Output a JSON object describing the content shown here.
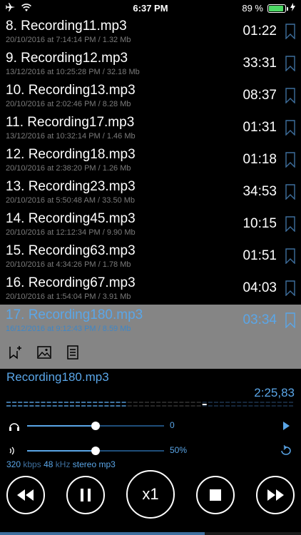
{
  "status_bar": {
    "time": "6:37 PM",
    "battery_percent": "89 %",
    "battery_level": 0.89
  },
  "recordings": [
    {
      "title": "8. Recording11.mp3",
      "meta": "20/10/2016 at 7:14:14 PM / 1.32 Mb",
      "duration": "01:22"
    },
    {
      "title": "9. Recording12.mp3",
      "meta": "13/12/2016 at 10:25:28 PM / 32.18 Mb",
      "duration": "33:31"
    },
    {
      "title": "10. Recording13.mp3",
      "meta": "20/10/2016 at 2:02:46 PM / 8.28 Mb",
      "duration": "08:37"
    },
    {
      "title": "11. Recording17.mp3",
      "meta": "13/12/2016 at 10:32:14 PM / 1.46 Mb",
      "duration": "01:31"
    },
    {
      "title": "12. Recording18.mp3",
      "meta": "20/10/2016 at 2:38:20 PM / 1.26 Mb",
      "duration": "01:18"
    },
    {
      "title": "13. Recording23.mp3",
      "meta": "20/10/2016 at 5:50:48 AM / 33.50 Mb",
      "duration": "34:53"
    },
    {
      "title": "14. Recording45.mp3",
      "meta": "20/10/2016 at 12:12:34 PM / 9.90 Mb",
      "duration": "10:15"
    },
    {
      "title": "15. Recording63.mp3",
      "meta": "20/10/2016 at 4:34:26 PM / 1.78 Mb",
      "duration": "01:51"
    },
    {
      "title": "16. Recording67.mp3",
      "meta": "20/10/2016 at 1:54:04 PM / 3.91 Mb",
      "duration": "04:03"
    },
    {
      "title": "17. Recording180.mp3",
      "meta": "16/12/2016 at 9:12:43 PM / 8.59 Mb",
      "duration": "03:34",
      "selected": true
    }
  ],
  "action_bar": {
    "icons": [
      "add-bookmark-icon",
      "image-icon",
      "notes-icon"
    ]
  },
  "player": {
    "title": "Recording180.mp3",
    "time": "2:25,83",
    "position_fraction": 0.68,
    "pitch_value": "0",
    "pitch_fraction": 0.5,
    "volume_value": "50%",
    "volume_fraction": 0.5,
    "bitrate": "320",
    "bitrate_unit": "kbps",
    "samplerate": "48",
    "samplerate_unit": "kHz",
    "channels": "stereo",
    "format": "mp3",
    "speed_label": "x1"
  },
  "colors": {
    "accent": "#5aa6e8",
    "selected_bg": "#858585",
    "background": "#000000"
  }
}
